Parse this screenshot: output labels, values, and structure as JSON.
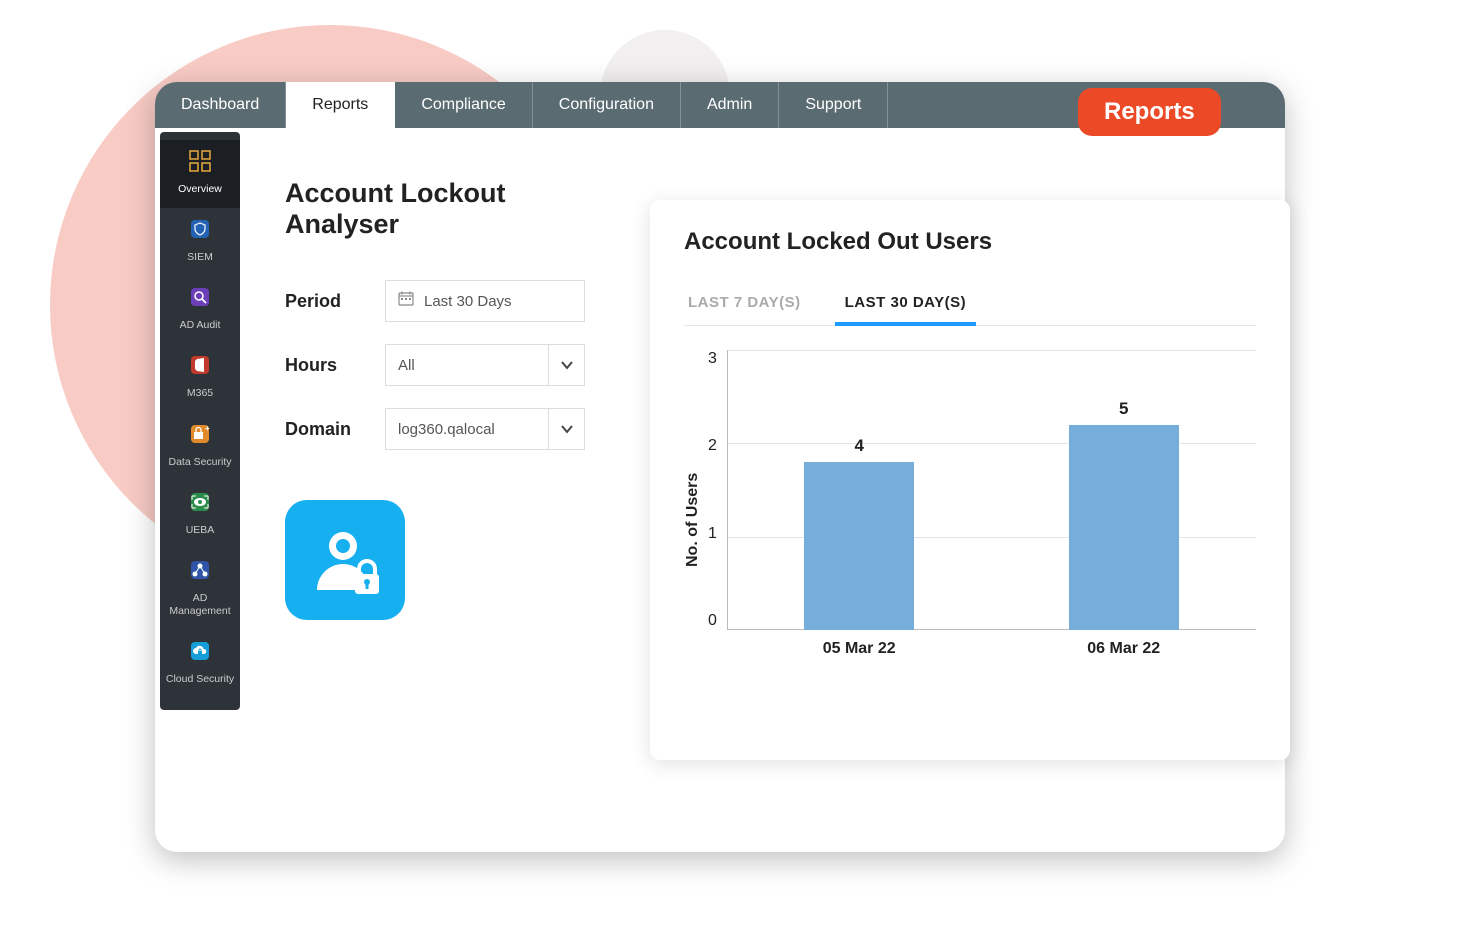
{
  "tabs": [
    "Dashboard",
    "Reports",
    "Compliance",
    "Configuration",
    "Admin",
    "Support"
  ],
  "active_tab": "Reports",
  "reports_badge": "Reports",
  "sidebar": {
    "items": [
      {
        "label": "Overview"
      },
      {
        "label": "SIEM"
      },
      {
        "label": "AD Audit"
      },
      {
        "label": "M365"
      },
      {
        "label": "Data Security"
      },
      {
        "label": "UEBA"
      },
      {
        "label": "AD Management"
      },
      {
        "label": "Cloud Security"
      }
    ],
    "active_index": 0
  },
  "page_title": "Account Lockout Analyser",
  "form": {
    "period_label": "Period",
    "period_value": "Last 30 Days",
    "hours_label": "Hours",
    "hours_value": "All",
    "domain_label": "Domain",
    "domain_value": "log360.qalocal"
  },
  "chart_card": {
    "title": "Account Locked Out Users",
    "tabs": [
      "LAST 7 DAY(S)",
      "LAST 30 DAY(S)"
    ],
    "active_tab": 1
  },
  "chart_data": {
    "type": "bar",
    "title": "Account Locked Out Users",
    "categories": [
      "05 Mar 22",
      "06 Mar 22"
    ],
    "values": [
      4,
      5
    ],
    "bar_labels": [
      "4",
      "5"
    ],
    "ylabel": "No. of Users",
    "yticks": [
      0,
      1,
      2,
      3
    ],
    "ylim": [
      0,
      3
    ],
    "bar_color": "#76aedb"
  }
}
